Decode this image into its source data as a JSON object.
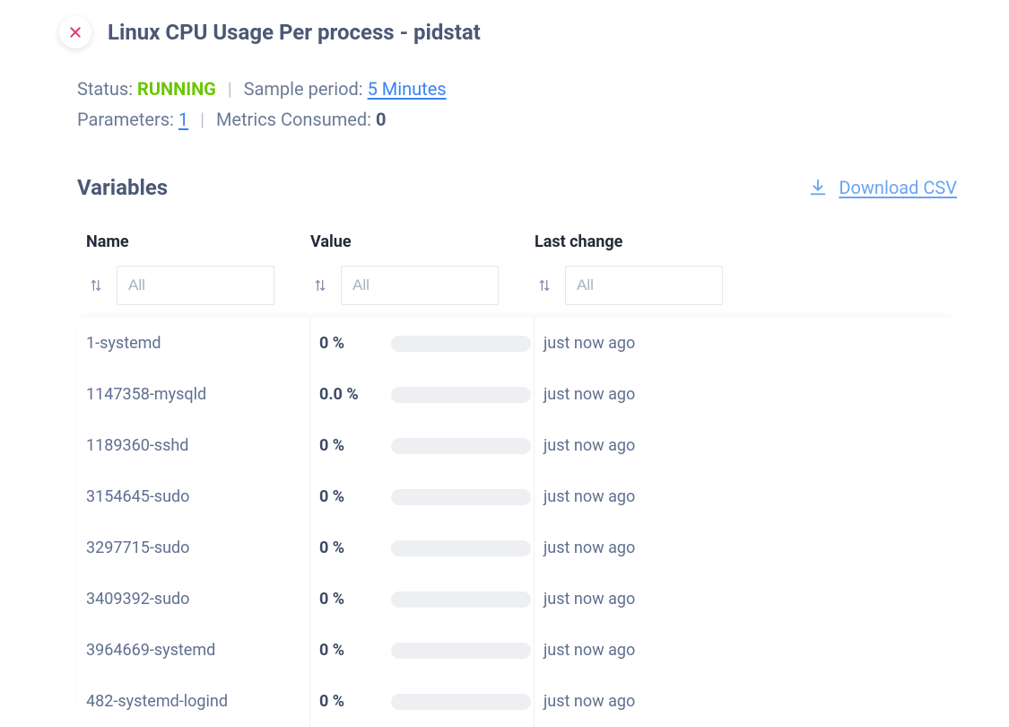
{
  "header": {
    "title": "Linux CPU Usage Per process - pidstat"
  },
  "status": {
    "status_label": "Status: ",
    "status_value": "RUNNING",
    "sample_period_label": "Sample period: ",
    "sample_period_value": "5 Minutes",
    "parameters_label": "Parameters: ",
    "parameters_value": "1",
    "metrics_label": "Metrics Consumed: ",
    "metrics_value": "0"
  },
  "section": {
    "variables_title": "Variables",
    "download_csv": "Download CSV"
  },
  "table": {
    "headers": {
      "name": "Name",
      "value": "Value",
      "last_change": "Last change"
    },
    "filter_placeholder": "All",
    "rows": [
      {
        "name": "1-systemd",
        "value": "0 %",
        "last_change": "just now ago"
      },
      {
        "name": "1147358-mysqld",
        "value": "0.0 %",
        "last_change": "just now ago"
      },
      {
        "name": "1189360-sshd",
        "value": "0 %",
        "last_change": "just now ago"
      },
      {
        "name": "3154645-sudo",
        "value": "0 %",
        "last_change": "just now ago"
      },
      {
        "name": "3297715-sudo",
        "value": "0 %",
        "last_change": "just now ago"
      },
      {
        "name": "3409392-sudo",
        "value": "0 %",
        "last_change": "just now ago"
      },
      {
        "name": "3964669-systemd",
        "value": "0 %",
        "last_change": "just now ago"
      },
      {
        "name": "482-systemd-logind",
        "value": "0 %",
        "last_change": "just now ago"
      }
    ]
  }
}
